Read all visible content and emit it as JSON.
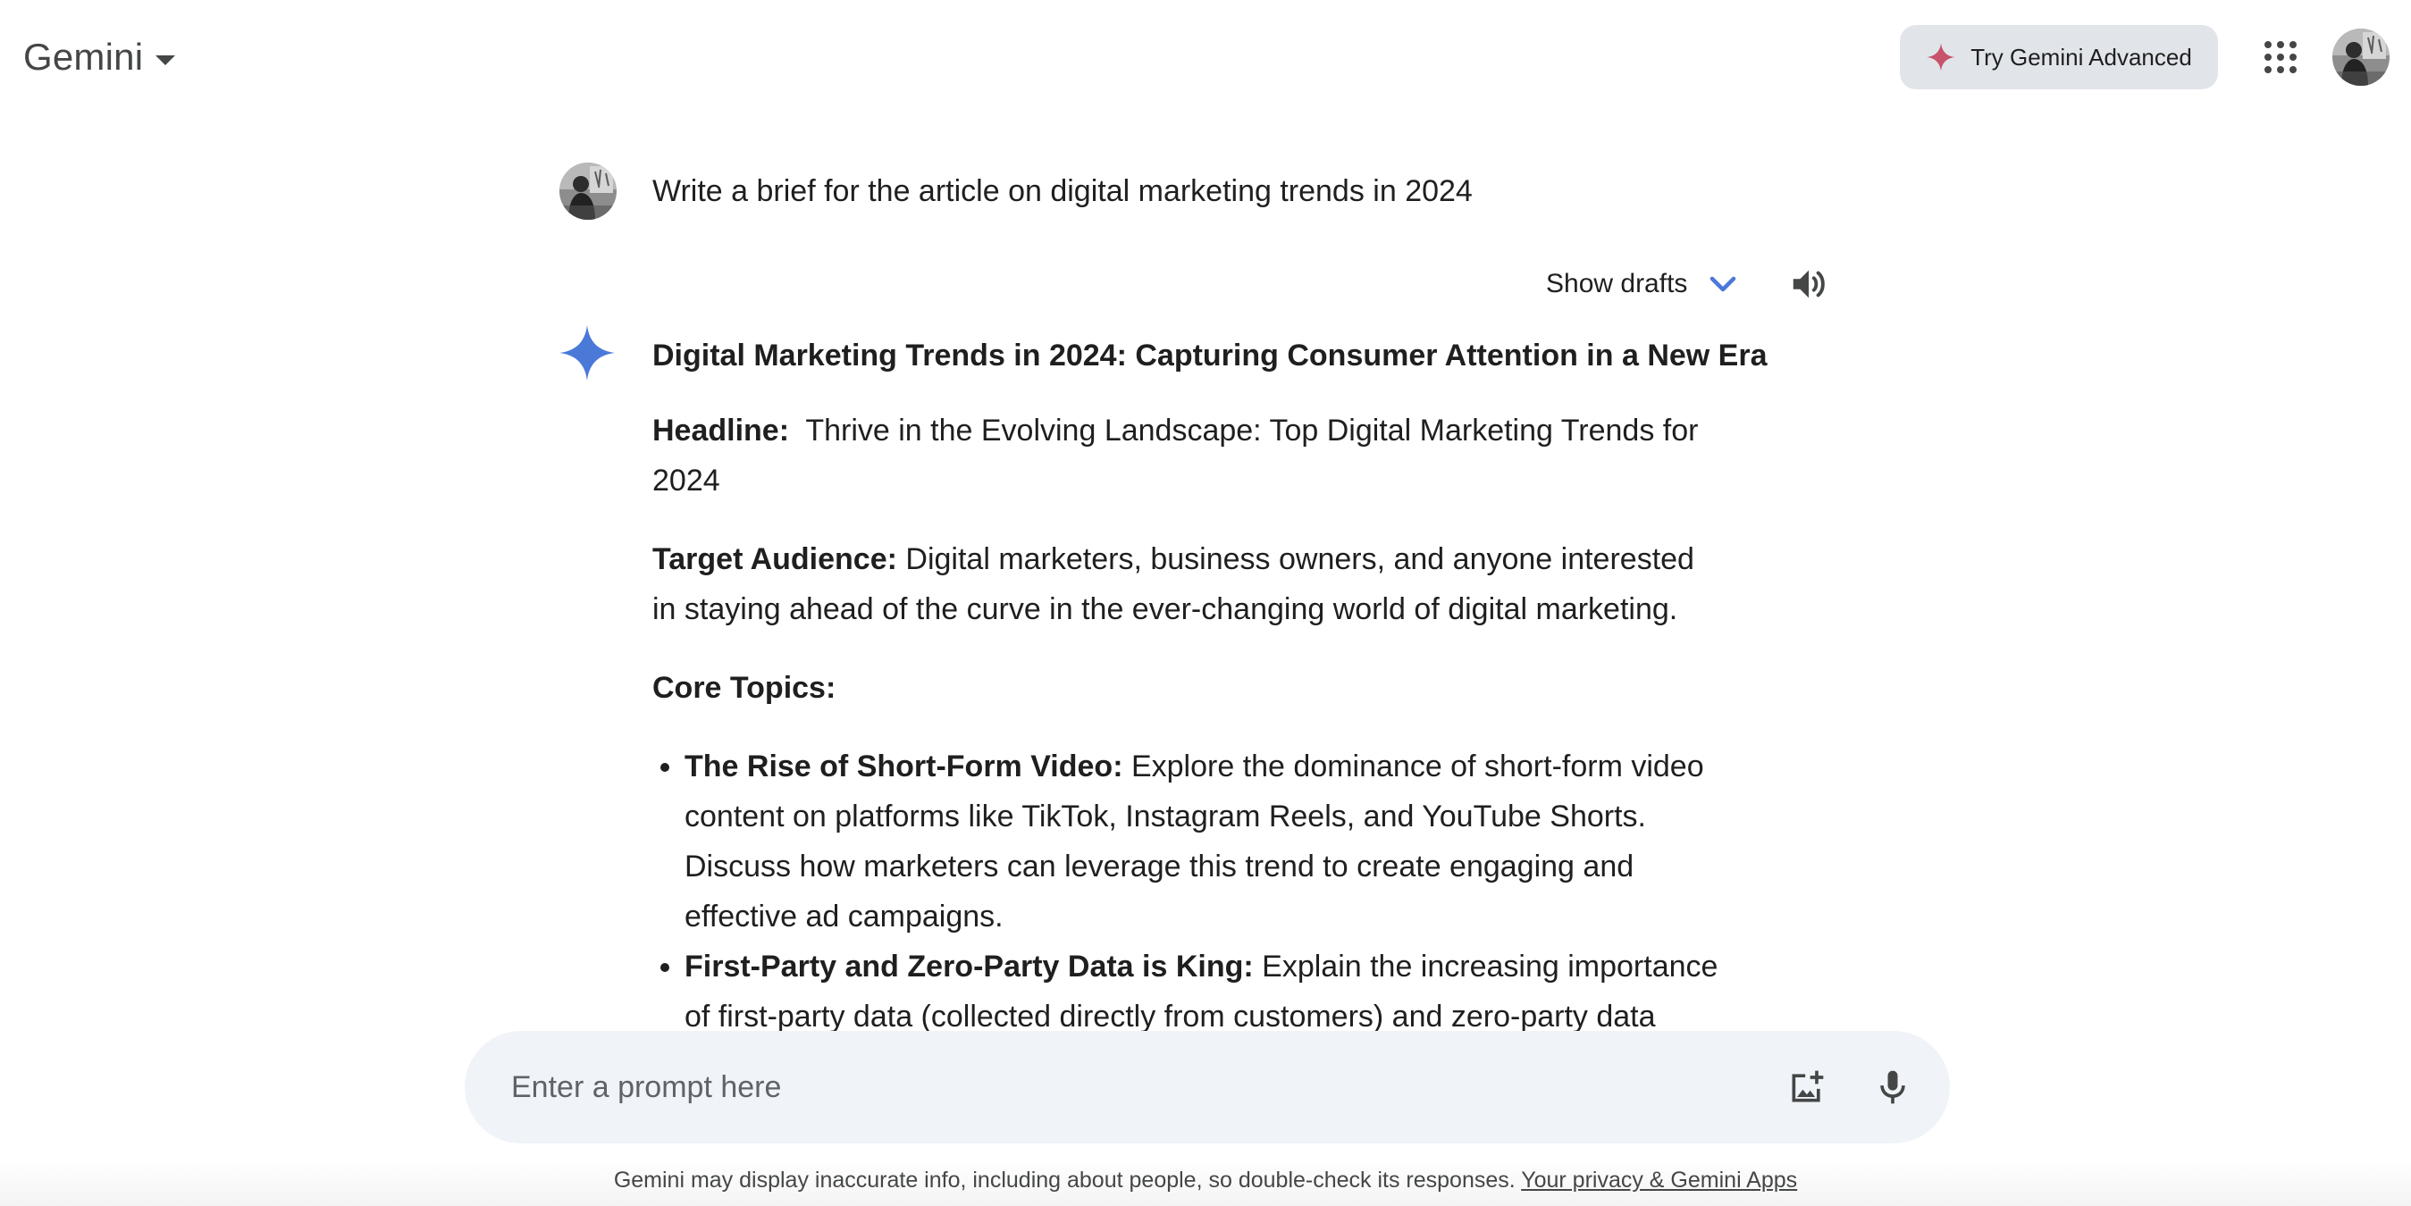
{
  "header": {
    "brand": "Gemini",
    "try_advanced_label": "Try Gemini Advanced"
  },
  "conversation": {
    "user_query": "Write a brief for the article on digital marketing trends in 2024",
    "show_drafts_label": "Show drafts",
    "response": {
      "title": "Digital Marketing Trends in 2024: Capturing Consumer Attention in a New Era",
      "headline_label": "Headline:",
      "headline_text": "Thrive in the Evolving Landscape: Top Digital Marketing Trends for 2024",
      "audience_label": "Target Audience:",
      "audience_text": "Digital marketers, business owners, and anyone interested in staying ahead of the curve in the ever-changing world of digital marketing.",
      "core_topics_label": "Core Topics:",
      "topics": [
        {
          "label": "The Rise of Short-Form Video:",
          "text": "Explore the dominance of short-form video content on platforms like TikTok, Instagram Reels, and YouTube Shorts. Discuss how marketers can leverage this trend to create engaging and effective ad campaigns."
        },
        {
          "label": "First-Party and Zero-Party Data is King:",
          "text": "Explain the increasing importance of first-party data (collected directly from customers) and zero-party data (voluntarily shared by customers). Explore strategies for collecting and utilizing"
        }
      ]
    }
  },
  "prompt": {
    "placeholder": "Enter a prompt here"
  },
  "footer": {
    "disclaimer": "Gemini may display inaccurate info, including about people, so double-check its responses. ",
    "privacy_link": "Your privacy & Gemini Apps"
  },
  "icons": {
    "advanced": "sparkle-icon",
    "apps": "apps-grid-icon",
    "drafts": "chevron-down-icon",
    "speaker": "speaker-icon",
    "gemini": "gemini-spark-icon",
    "image_upload": "add-image-icon",
    "mic": "microphone-icon"
  },
  "colors": {
    "accent": "#4b79d8",
    "prompt_bg": "#f0f4f9",
    "button_bg": "#e1e5ea",
    "advanced_sparkle": "#c7546b"
  }
}
